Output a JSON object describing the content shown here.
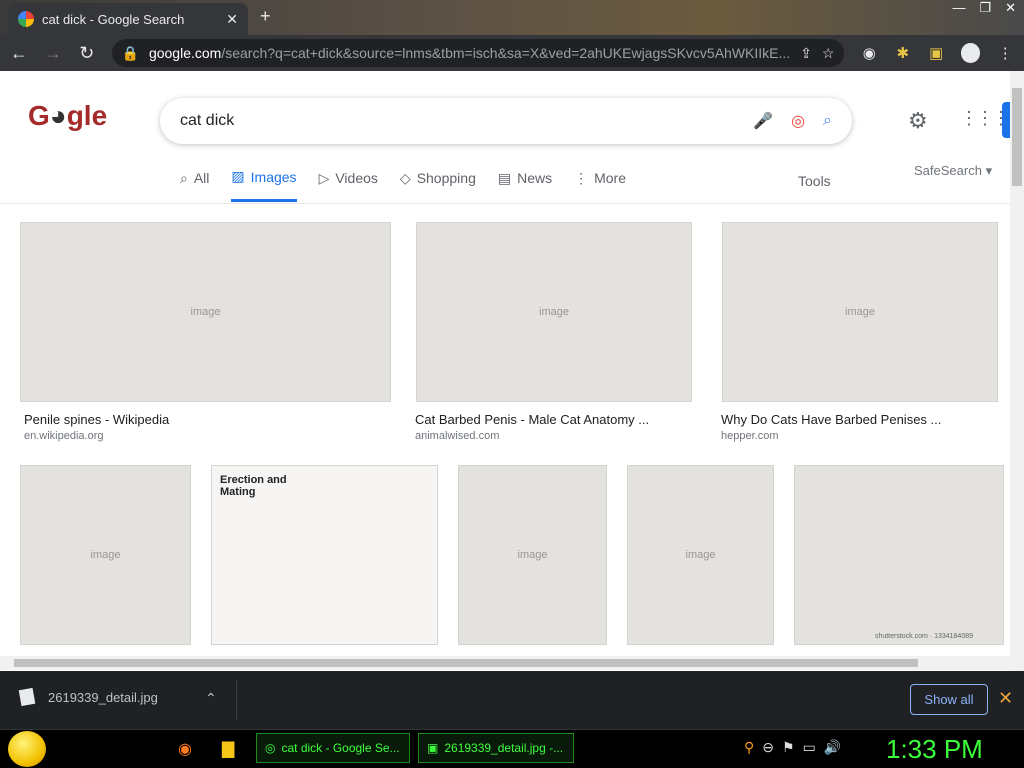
{
  "browser": {
    "tab_title": "cat dick - Google Search",
    "url_host": "google.com",
    "url_path": "/search?q=cat+dick&source=lnms&tbm=isch&sa=X&ved=2ahUKEwjagsSKvcv5AhWKIIkE..."
  },
  "search": {
    "query": "cat dick",
    "tabs": [
      "All",
      "Images",
      "Videos",
      "Shopping",
      "News",
      "More"
    ],
    "active_tab": "Images",
    "tools_label": "Tools",
    "safesearch_label": "SafeSearch"
  },
  "results_row1": [
    {
      "caption": "Penile spines - Wikipedia",
      "source": "en.wikipedia.org"
    },
    {
      "caption": "Cat Barbed Penis - Male Cat Anatomy ...",
      "source": "animalwised.com"
    },
    {
      "caption": "Why Do Cats Have Barbed Penises ...",
      "source": "hepper.com"
    }
  ],
  "results_row2_text": {
    "diagram_title": "Erection and Mating",
    "watermark": "shutterstock.com · 1334184089"
  },
  "image_placeholder_label": "image",
  "download": {
    "filename": "2619339_detail.jpg",
    "show_all": "Show all"
  },
  "taskbar": {
    "task1": "cat dick - Google Se...",
    "task2": "2619339_detail.jpg -...",
    "clock": "1:33 PM"
  },
  "colors": {
    "accent": "#1a73e8",
    "taskbar_green": "#3cff3c"
  }
}
